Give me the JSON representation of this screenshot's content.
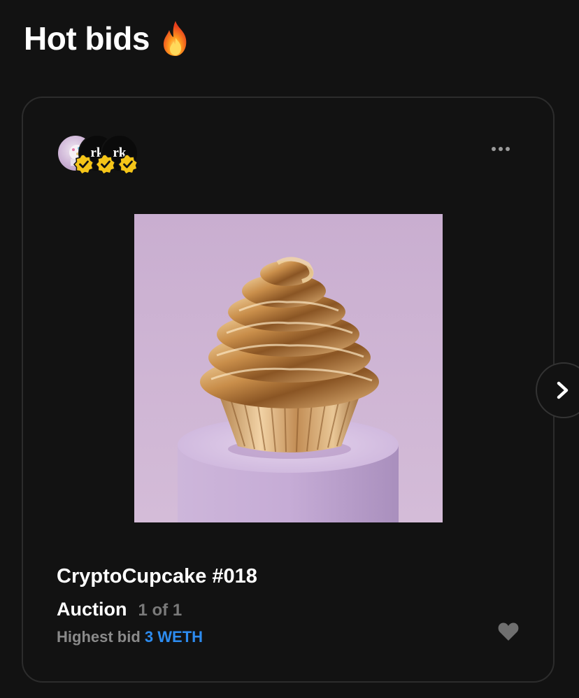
{
  "section": {
    "title": "Hot bids",
    "emoji_icon": "fire-icon"
  },
  "card": {
    "avatars": [
      {
        "type": "image",
        "icon": "cupcake-avatar",
        "badge": "verified-badge-icon"
      },
      {
        "label": "rk",
        "badge": "verified-badge-icon"
      },
      {
        "label": "rk",
        "badge": "verified-badge-icon"
      }
    ],
    "menu_icon": "more-dots-icon",
    "artwork": {
      "description_icon": "golden-cupcake-artwork"
    },
    "title": "CryptoCupcake #018",
    "sale_type": "Auction",
    "edition": "1 of 1",
    "bid_label": "Highest bid",
    "bid_value": "3 WETH",
    "like_icon": "heart-icon"
  },
  "carousel": {
    "next_icon": "chevron-right-icon"
  },
  "colors": {
    "background": "#121212",
    "card_border": "#2c2c2c",
    "accent_blue": "#2d8cf0",
    "badge_yellow": "#f5c518",
    "muted_text": "#7a7a7a"
  }
}
